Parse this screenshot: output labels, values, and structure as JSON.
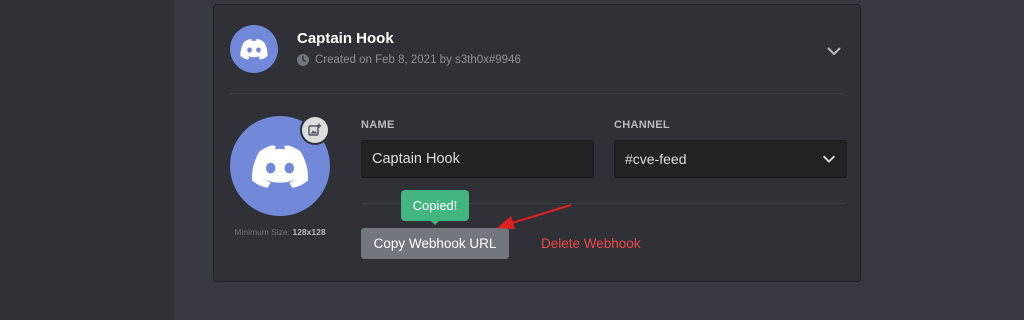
{
  "colors": {
    "background": "#36393f",
    "card": "#2f3136",
    "blurple": "#7289da",
    "tooltip_green": "#43b581",
    "danger_red": "#f04747",
    "annotation_arrow": "#e02020"
  },
  "webhook": {
    "name": "Captain Hook",
    "created_text": "Created on Feb 8, 2021 by s3th0x#9946",
    "icons": {
      "clock": "clock-icon",
      "expand": "chevron-down-icon",
      "avatar": "discord-logo-icon",
      "upload": "image-add-icon"
    }
  },
  "avatar": {
    "min_size_label": "Minimum Size:",
    "min_size_value": "128x128"
  },
  "form": {
    "name_label": "NAME",
    "name_value": "Captain Hook",
    "channel_label": "CHANNEL",
    "channel_value": "#cve-feed"
  },
  "actions": {
    "copy_label": "Copy Webhook URL",
    "delete_label": "Delete Webhook",
    "tooltip": "Copied!"
  }
}
